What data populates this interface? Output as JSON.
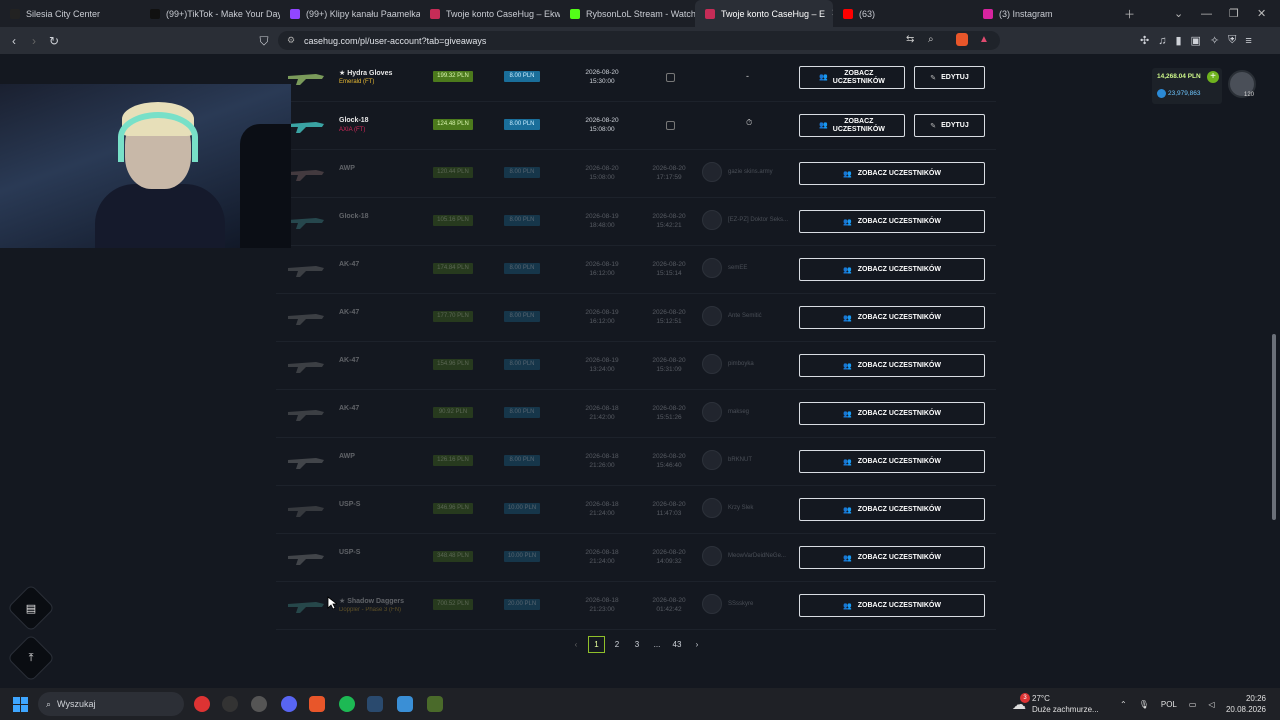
{
  "browser": {
    "tabs": [
      {
        "title": "Silesia City Center",
        "color": "#222222"
      },
      {
        "title": "(99+)TikTok - Make Your Day",
        "color": "#111111"
      },
      {
        "title": "(99+) Klipy kanału Paamelka -",
        "color": "#9146ff"
      },
      {
        "title": "Twoje konto CaseHug – Ekwip",
        "color": "#c62c57"
      },
      {
        "title": "RybsonLoL Stream - Watch Li",
        "color": "#53fc18"
      },
      {
        "title": "Twoje konto CaseHug – E",
        "color": "#c62c57"
      },
      {
        "title": "(63)",
        "color": "#ff0000"
      },
      {
        "title": "(3) Instagram",
        "color": "#d6249f"
      }
    ],
    "url": "casehug.com/pl/user-account?tab=giveaways"
  },
  "wallet": {
    "balance": "14,268.04 PLN",
    "coins": "23,979,863",
    "level": "120"
  },
  "labels": {
    "view_participants": "ZOBACZ UCZESTNIKÓW",
    "view_participants_line1": "ZOBACZ",
    "view_participants_line2": "UCZESTNIKÓW",
    "edit": "EDYTUJ"
  },
  "rows": [
    {
      "name": "★ Hydra Gloves",
      "sub": "Emerald (FT)",
      "sub_color": "#e7b933",
      "price": "199.32 PLN",
      "fee": "8.00 PLN",
      "start": "2026-08-20",
      "start_time": "15:30:00",
      "end": "",
      "end_time": "",
      "winner": "-",
      "mode": "edit",
      "faded": false
    },
    {
      "name": "Glock-18",
      "sub": "AXIA (FT)",
      "sub_color": "#d6295c",
      "price": "124.48 PLN",
      "fee": "8.00 PLN",
      "start": "2026-08-20",
      "start_time": "15:08:00",
      "end": "",
      "end_time": "",
      "winner": "",
      "mode": "edit",
      "faded": false
    },
    {
      "name": "AWP",
      "sub": "",
      "sub_color": "#d6295c",
      "price": "120.44 PLN",
      "fee": "8.00 PLN",
      "start": "2026-08-20",
      "start_time": "15:08:00",
      "end": "2026-08-20",
      "end_time": "17:17:59",
      "winner": "gazie skins.army",
      "mode": "view",
      "faded": true
    },
    {
      "name": "Glock-18",
      "sub": "",
      "sub_color": "#d6295c",
      "price": "105.16 PLN",
      "fee": "8.00 PLN",
      "start": "2026-08-19",
      "start_time": "18:48:00",
      "end": "2026-08-20",
      "end_time": "15:42:21",
      "winner": "[EZ-PZ] Doktor Seks...",
      "mode": "view",
      "faded": true
    },
    {
      "name": "AK-47",
      "sub": "",
      "sub_color": "#d6295c",
      "price": "174.84 PLN",
      "fee": "8.00 PLN",
      "start": "2026-08-19",
      "start_time": "16:12:00",
      "end": "2026-08-20",
      "end_time": "15:15:14",
      "winner": "semEE",
      "mode": "view",
      "faded": true
    },
    {
      "name": "AK-47",
      "sub": "",
      "sub_color": "#d6295c",
      "price": "177.70 PLN",
      "fee": "8.00 PLN",
      "start": "2026-08-19",
      "start_time": "16:12:00",
      "end": "2026-08-20",
      "end_time": "15:12:51",
      "winner": "Ante Semitić",
      "mode": "view",
      "faded": true
    },
    {
      "name": "AK-47",
      "sub": "",
      "sub_color": "#d6295c",
      "price": "154.96 PLN",
      "fee": "8.00 PLN",
      "start": "2026-08-19",
      "start_time": "13:24:00",
      "end": "2026-08-20",
      "end_time": "15:31:09",
      "winner": "pimboyka",
      "mode": "view",
      "faded": true
    },
    {
      "name": "AK-47",
      "sub": "",
      "sub_color": "#d6295c",
      "price": "90.92 PLN",
      "fee": "8.00 PLN",
      "start": "2026-08-18",
      "start_time": "21:42:00",
      "end": "2026-08-20",
      "end_time": "15:51:26",
      "winner": "makseg",
      "mode": "view",
      "faded": true
    },
    {
      "name": "AWP",
      "sub": "",
      "sub_color": "#d6295c",
      "price": "126.16 PLN",
      "fee": "8.00 PLN",
      "start": "2026-08-18",
      "start_time": "21:26:00",
      "end": "2026-08-20",
      "end_time": "15:46:40",
      "winner": "bRKNUT",
      "mode": "view",
      "faded": true
    },
    {
      "name": "USP-S",
      "sub": "",
      "sub_color": "#d6295c",
      "price": "346.96 PLN",
      "fee": "10.00 PLN",
      "start": "2026-08-18",
      "start_time": "21:24:00",
      "end": "2026-08-20",
      "end_time": "11:47:03",
      "winner": "Krzy Slek",
      "mode": "view",
      "faded": true
    },
    {
      "name": "USP-S",
      "sub": "",
      "sub_color": "#d6295c",
      "price": "348.48 PLN",
      "fee": "10.00 PLN",
      "start": "2026-08-18",
      "start_time": "21:24:00",
      "end": "2026-08-20",
      "end_time": "14:09:32",
      "winner": "MeowVarDeidNeGe...",
      "mode": "view",
      "faded": true
    },
    {
      "name": "★ Shadow Daggers",
      "sub": "Doppler - Phase 3 (FN)",
      "sub_color": "#e7b933",
      "price": "700.52 PLN",
      "fee": "20.00 PLN",
      "start": "2026-08-18",
      "start_time": "21:23:00",
      "end": "2026-08-20",
      "end_time": "01:42:42",
      "winner": "SSsskyre",
      "mode": "view",
      "faded": true
    }
  ],
  "pagination": {
    "prev": "‹",
    "pages": [
      "1",
      "2",
      "3",
      "...",
      "43"
    ],
    "next": "›",
    "active": "1"
  },
  "taskbar": {
    "search": "Wyszukaj",
    "weather_temp": "27°C",
    "weather_desc": "Duże zachmurze...",
    "lang": "POL",
    "time": "20:26",
    "date": "20.08.2026",
    "weather_badge": "3"
  }
}
